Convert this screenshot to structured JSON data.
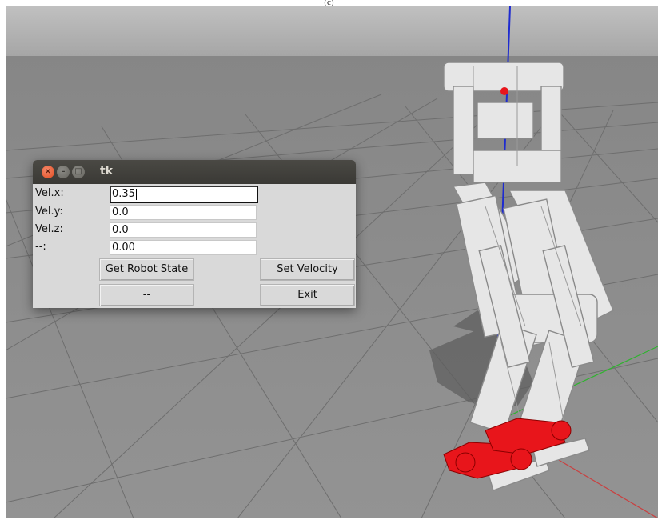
{
  "caption": "(c)",
  "window": {
    "title": "tk",
    "controls": {
      "close": "close-icon",
      "minimize": "minimize-icon",
      "maximize": "maximize-icon"
    }
  },
  "fields": [
    {
      "label": "Vel.x:",
      "value": "0.35",
      "focused": true
    },
    {
      "label": "Vel.y:",
      "value": "0.0",
      "focused": false
    },
    {
      "label": "Vel.z:",
      "value": "0.0",
      "focused": false
    },
    {
      "label": "--:",
      "value": "0.00",
      "focused": false
    }
  ],
  "buttons": {
    "get_state": "Get Robot State",
    "set_velocity": "Set Velocity",
    "dash": "--",
    "exit": "Exit"
  },
  "scene": {
    "ground_color": "#8c8c8c",
    "sky_color": "#b8b8b8",
    "robot_body_color": "#e6e6e6",
    "robot_feet_color": "#e8151b",
    "axis_colors": {
      "z": "#1e2bd0",
      "y": "#2fb32f",
      "x": "#c94040"
    }
  }
}
